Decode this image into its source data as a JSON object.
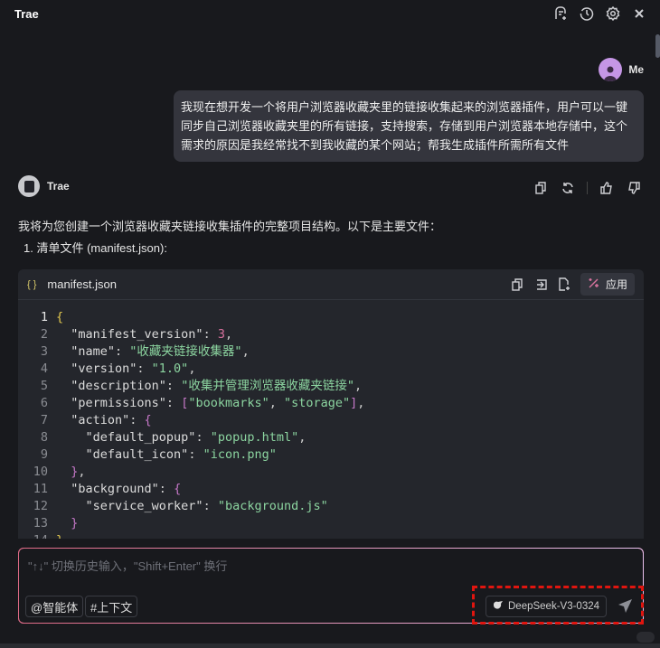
{
  "app": {
    "title": "Trae"
  },
  "header_icons": [
    "new-chat-icon",
    "history-icon",
    "gear-icon",
    "close-icon"
  ],
  "user": {
    "name": "Me",
    "message": "我现在想开发一个将用户浏览器收藏夹里的链接收集起来的浏览器插件，用户可以一键同步自己浏览器收藏夹里的所有链接，支持搜索，存储到用户浏览器本地存储中，这个需求的原因是我经常找不到我收藏的某个网站；帮我生成插件所需所有文件"
  },
  "assistant": {
    "name": "Trae",
    "intro": "我将为您创建一个浏览器收藏夹链接收集插件的完整项目结构。以下是主要文件：",
    "list_item": "1. 清单文件 (manifest.json):"
  },
  "code_block": {
    "filename": "manifest.json",
    "brace_icon": "{ }",
    "apply_label": "应用",
    "lines": [
      [
        [
          "b",
          "{"
        ]
      ],
      [
        [
          "k",
          "  \"manifest_version\""
        ],
        [
          "p",
          ": "
        ],
        [
          "n",
          "3"
        ],
        [
          "p",
          ","
        ]
      ],
      [
        [
          "k",
          "  \"name\""
        ],
        [
          "p",
          ": "
        ],
        [
          "s",
          "\"收藏夹链接收集器\""
        ],
        [
          "p",
          ","
        ]
      ],
      [
        [
          "k",
          "  \"version\""
        ],
        [
          "p",
          ": "
        ],
        [
          "s",
          "\"1.0\""
        ],
        [
          "p",
          ","
        ]
      ],
      [
        [
          "k",
          "  \"description\""
        ],
        [
          "p",
          ": "
        ],
        [
          "s",
          "\"收集并管理浏览器收藏夹链接\""
        ],
        [
          "p",
          ","
        ]
      ],
      [
        [
          "k",
          "  \"permissions\""
        ],
        [
          "p",
          ": "
        ],
        [
          "m",
          "["
        ],
        [
          "s",
          "\"bookmarks\""
        ],
        [
          "p",
          ", "
        ],
        [
          "s",
          "\"storage\""
        ],
        [
          "m",
          "]"
        ],
        [
          "p",
          ","
        ]
      ],
      [
        [
          "k",
          "  \"action\""
        ],
        [
          "p",
          ": "
        ],
        [
          "m",
          "{"
        ]
      ],
      [
        [
          "k",
          "    \"default_popup\""
        ],
        [
          "p",
          ": "
        ],
        [
          "s",
          "\"popup.html\""
        ],
        [
          "p",
          ","
        ]
      ],
      [
        [
          "k",
          "    \"default_icon\""
        ],
        [
          "p",
          ": "
        ],
        [
          "s",
          "\"icon.png\""
        ]
      ],
      [
        [
          "m",
          "  }"
        ],
        [
          "p",
          ","
        ]
      ],
      [
        [
          "k",
          "  \"background\""
        ],
        [
          "p",
          ": "
        ],
        [
          "m",
          "{"
        ]
      ],
      [
        [
          "k",
          "    \"service_worker\""
        ],
        [
          "p",
          ": "
        ],
        [
          "s",
          "\"background.js\""
        ]
      ],
      [
        [
          "m",
          "  }"
        ]
      ],
      [
        [
          "b",
          "}"
        ]
      ]
    ]
  },
  "input": {
    "placeholder": "\"↑↓\" 切换历史输入，\"Shift+Enter\" 换行",
    "agent_chip": "@智能体",
    "context_chip": "#上下文",
    "model": "DeepSeek-V3-0324"
  },
  "colors": {
    "highlight": "#e0150f",
    "accent": "#c596e6"
  }
}
